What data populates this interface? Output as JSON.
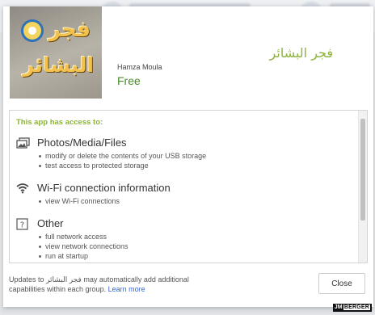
{
  "app": {
    "title": "فجر البشائر",
    "icon_text_line1": "فجر",
    "icon_text_line2": "البشائر",
    "developer": "Hamza Moula",
    "price": "Free"
  },
  "permissions": {
    "header": "This app has access to:",
    "groups": [
      {
        "title": "Photos/Media/Files",
        "icon": "photos-media-icon",
        "items": [
          "modify or delete the contents of your USB storage",
          "test access to protected storage"
        ]
      },
      {
        "title": "Wi-Fi connection information",
        "icon": "wifi-icon",
        "items": [
          "view Wi-Fi connections"
        ]
      },
      {
        "title": "Other",
        "icon": "question-mark-icon",
        "items": [
          "full network access",
          "view network connections",
          "run at startup"
        ]
      }
    ]
  },
  "footer": {
    "text_prefix": "Updates to",
    "app_name": "فجر البشائر",
    "text_suffix": "may automatically add additional capabilities within each group.",
    "learn_more": "Learn more"
  },
  "buttons": {
    "close": "Close"
  },
  "watermark": {
    "part1": "JM",
    "part2": "BERGER"
  },
  "colors": {
    "accent_green": "#8db33a",
    "price_green": "#4a8a2a",
    "link_blue": "#3367d6"
  }
}
